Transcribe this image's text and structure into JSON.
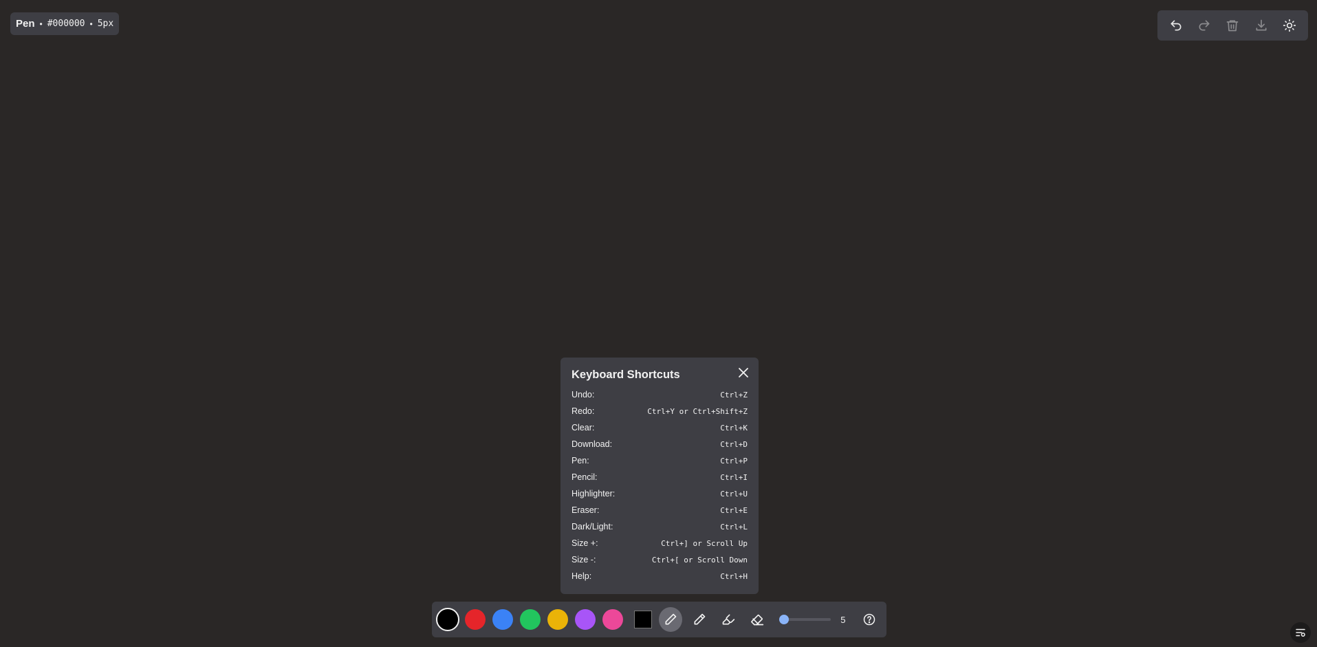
{
  "status": {
    "tool": "Pen",
    "separator": "•",
    "color": "#000000",
    "size": "5px"
  },
  "top_toolbar": {
    "buttons": [
      {
        "icon": "undo-icon",
        "enabled": true
      },
      {
        "icon": "redo-icon",
        "enabled": false
      },
      {
        "icon": "trash-icon",
        "enabled": false
      },
      {
        "icon": "download-icon",
        "enabled": false
      },
      {
        "icon": "sun-icon",
        "enabled": true
      }
    ]
  },
  "shortcuts": {
    "title": "Keyboard Shortcuts",
    "rows": [
      {
        "label": "Undo:",
        "key": "Ctrl+Z"
      },
      {
        "label": "Redo:",
        "key": "Ctrl+Y or Ctrl+Shift+Z"
      },
      {
        "label": "Clear:",
        "key": "Ctrl+K"
      },
      {
        "label": "Download:",
        "key": "Ctrl+D"
      },
      {
        "label": "Pen:",
        "key": "Ctrl+P"
      },
      {
        "label": "Pencil:",
        "key": "Ctrl+I"
      },
      {
        "label": "Highlighter:",
        "key": "Ctrl+U"
      },
      {
        "label": "Eraser:",
        "key": "Ctrl+E"
      },
      {
        "label": "Dark/Light:",
        "key": "Ctrl+L"
      },
      {
        "label": "Size +:",
        "key": "Ctrl+] or Scroll Up"
      },
      {
        "label": "Size -:",
        "key": "Ctrl+[ or Scroll Down"
      },
      {
        "label": "Help:",
        "key": "Ctrl+H"
      }
    ]
  },
  "palette": {
    "swatches": [
      "#000000",
      "#e5252a",
      "#3b82f6",
      "#22c55e",
      "#eab308",
      "#a855f7",
      "#ec4899"
    ],
    "selected": "#000000",
    "custom_color": "#000000"
  },
  "tools": {
    "items": [
      "pen-icon",
      "pencil-icon",
      "highlighter-icon",
      "eraser-icon"
    ],
    "active": "pen-icon"
  },
  "size": {
    "value": "5",
    "fraction": 0.05
  },
  "help": {
    "icon": "help-icon"
  },
  "corner": {
    "icon": "settings-panel-icon"
  },
  "colors": {
    "background": "#2a2726",
    "panel": "#3e3e44",
    "accent": "#8ab4f8"
  }
}
